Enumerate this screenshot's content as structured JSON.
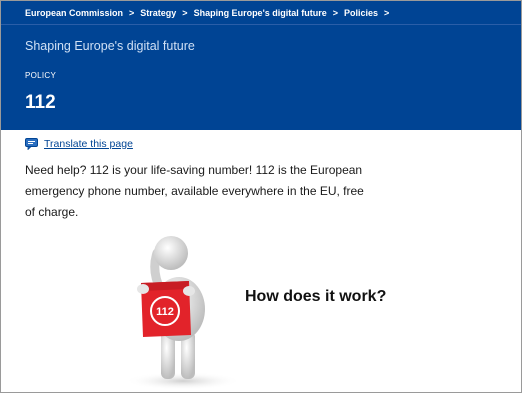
{
  "breadcrumb": {
    "items": [
      "European Commission",
      "Strategy",
      "Shaping Europe's digital future",
      "Policies"
    ],
    "separator": ">"
  },
  "header": {
    "site_title": "Shaping Europe's digital future",
    "policy_label": "POLICY",
    "page_title": "112"
  },
  "translate": {
    "icon": "speech-bubble-icon",
    "link_label": "Translate this page"
  },
  "intro": {
    "text": "Need help? 112 is your life-saving number! 112 is the European emergency phone number, available everywhere in the EU, free of charge."
  },
  "illustration": {
    "sign_text": "112"
  },
  "how_heading": "How does it work?",
  "colors": {
    "brand_blue": "#004494",
    "sign_red": "#e2232a"
  }
}
